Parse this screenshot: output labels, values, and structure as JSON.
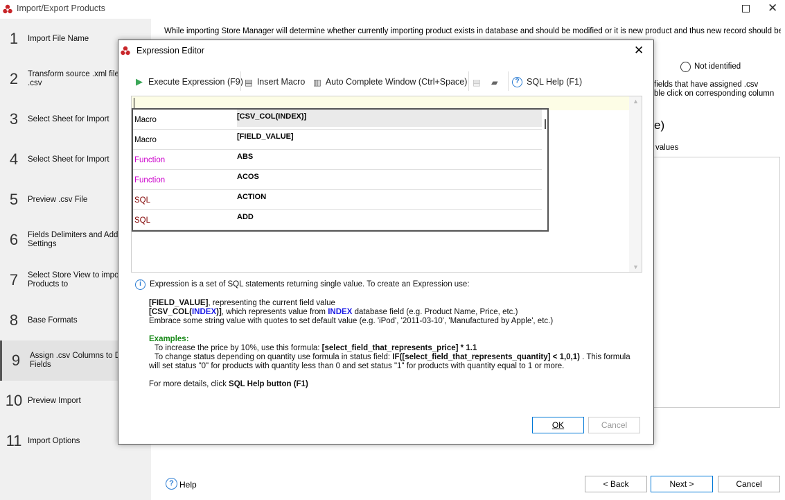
{
  "window": {
    "title": "Import/Export Products"
  },
  "sidebar": {
    "items": [
      {
        "n": "1",
        "label": "Import File Name"
      },
      {
        "n": "2",
        "label": "Transform source .xml file\n.csv"
      },
      {
        "n": "3",
        "label": "Select Sheet for Import"
      },
      {
        "n": "4",
        "label": "Select Sheet for Import"
      },
      {
        "n": "5",
        "label": "Preview .csv File"
      },
      {
        "n": "6",
        "label": "Fields Delimiters and Additi\nSettings"
      },
      {
        "n": "7",
        "label": "Select Store View to import\nProducts to"
      },
      {
        "n": "8",
        "label": "Base Formats"
      },
      {
        "n": "9",
        "label": "Assign .csv Columns to Dat\nFields",
        "active": true
      },
      {
        "n": "10",
        "label": "Preview Import"
      },
      {
        "n": "11",
        "label": "Import Options"
      }
    ]
  },
  "main": {
    "intro": "While importing Store Manager will determine whether currently importing product exists in database and should be modified or it is new product and thus new record should be created",
    "radio_not_identified": "Not identified",
    "hint_line1": "fields that have assigned .csv",
    "hint_line2": "ble click on corresponding column",
    "heading_fragment": "e)",
    "values_label": "values",
    "help": "Help",
    "back": "< Back",
    "next": "Next >",
    "cancel": "Cancel"
  },
  "dialog": {
    "title": "Expression Editor",
    "toolbar": {
      "execute": "Execute Expression (F9)",
      "insert_macro": "Insert Macro",
      "auto_complete": "Auto Complete Window (Ctrl+Space)",
      "sql_help": "SQL Help (F1)"
    },
    "autocomplete": [
      {
        "kind": "Macro",
        "value": "[CSV_COL(INDEX)]",
        "color": "#000000"
      },
      {
        "kind": "Macro",
        "value": "[FIELD_VALUE]",
        "color": "#000000"
      },
      {
        "kind": "Function",
        "value": "ABS",
        "color": "#cc00cc"
      },
      {
        "kind": "Function",
        "value": "ACOS",
        "color": "#cc00cc"
      },
      {
        "kind": "SQL",
        "value": "ACTION",
        "color": "#800000"
      },
      {
        "kind": "SQL",
        "value": "ADD",
        "color": "#800000"
      }
    ],
    "info": {
      "intro": "Expression is a set of SQL statements returning single value. To create an Expression use:",
      "fv_bold": "[FIELD_VALUE]",
      "fv_rest": ", representing the current field value",
      "csv_a": "[CSV_COL(",
      "csv_b": "INDEX",
      "csv_c": ")]",
      "csv_rest": ", which represents value from ",
      "csv_idx": "INDEX",
      "csv_rest2": " database field (e.g. Product Name, Price, etc.)",
      "embrace": "Embrace some string value with quotes to set default value (e.g. 'iPod', '2011-03-10', 'Manufactured by Apple', etc.)",
      "examples": "Examples:",
      "ex1": "To increase the price by 10%, use this formula: ",
      "ex1_b": "[select_field_that_represents_price] * 1.1",
      "ex2": "To change status depending on quantity use formula in status field: ",
      "ex2_b": "IF([select_field_that_represents_quantity] < 1,0,1)",
      "ex2_c": " . This formula",
      "ex2_line2": "will set status \"0\" for products with quantity less than 0 and set status \"1\" for products with quantity equal to 1 or more.",
      "more": "For more details, click ",
      "more_b": "SQL Help button (F1)"
    },
    "ok": "OK",
    "cancel": "Cancel"
  }
}
